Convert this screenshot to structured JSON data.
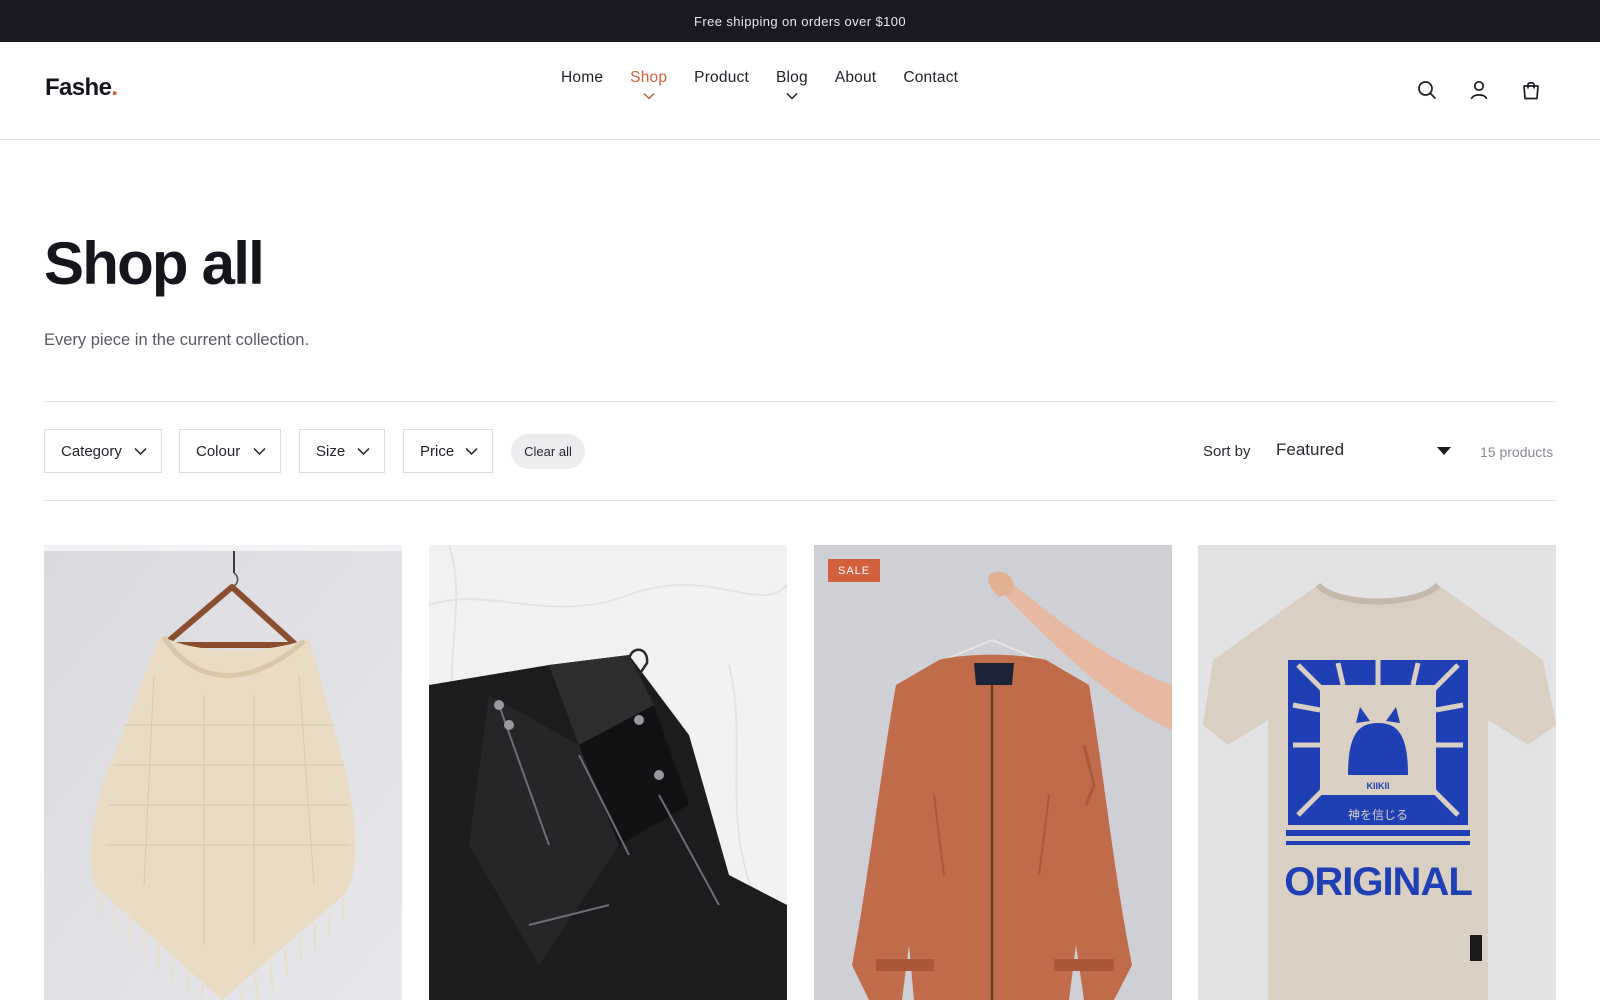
{
  "announcement": "Free shipping on orders over $100",
  "brand": {
    "name": "Fashe",
    "dot": ".",
    "accent_color": "#d2603c"
  },
  "nav": {
    "items": [
      {
        "label": "Home",
        "active": false,
        "has_dropdown": false
      },
      {
        "label": "Shop",
        "active": true,
        "has_dropdown": true
      },
      {
        "label": "Product",
        "active": false,
        "has_dropdown": false
      },
      {
        "label": "Blog",
        "active": false,
        "has_dropdown": true
      },
      {
        "label": "About",
        "active": false,
        "has_dropdown": false
      },
      {
        "label": "Contact",
        "active": false,
        "has_dropdown": false
      }
    ]
  },
  "header_icons": [
    "search-icon",
    "account-icon",
    "shopping-bag-icon"
  ],
  "page": {
    "title": "Shop all",
    "subtitle": "Every piece in the current collection."
  },
  "filters": {
    "items": [
      {
        "label": "Category"
      },
      {
        "label": "Colour"
      },
      {
        "label": "Size"
      },
      {
        "label": "Price"
      }
    ],
    "clear_label": "Clear all"
  },
  "sort": {
    "label": "Sort by",
    "selected": "Featured"
  },
  "product_count": "15 products",
  "products": [
    {
      "image": "cream knit poncho on wooden hanger",
      "badge": ""
    },
    {
      "image": "black leather biker jacket on white sheet",
      "badge": ""
    },
    {
      "image": "rust bomber jacket held on hanger",
      "badge": "SALE"
    },
    {
      "image": "beige graphic t-shirt with blue print",
      "badge": "",
      "print_text": "ORIGINAL",
      "print_small": "KIIKII",
      "print_jp": "神を信じる"
    }
  ],
  "colors": {
    "announcement_bg": "#1a1820",
    "text": "#1c1b22",
    "sale_badge": "#d2603c",
    "tee_print": "#1f3fb5"
  }
}
